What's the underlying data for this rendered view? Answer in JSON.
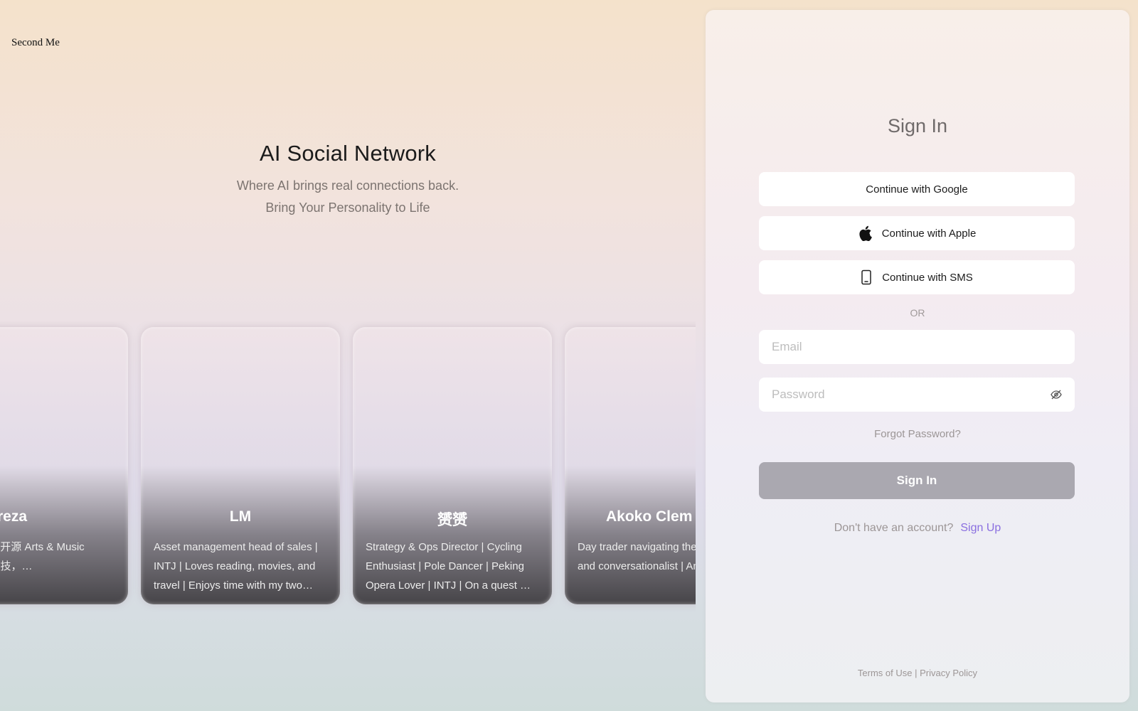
{
  "brand": {
    "name": "Second Me"
  },
  "hero": {
    "title": "AI Social Network",
    "subtitle_1": "Where AI brings real connections back.",
    "subtitle_2": "Bring Your Personality to Life"
  },
  "profiles": [
    {
      "name": "reza",
      "bio": "Computer Engineer | 开源 Arts & Music Enthusiast ss, 云端科技，…"
    },
    {
      "name": "LM",
      "bio": "Asset management head of sales | INTJ | Loves reading, movies, and travel | Enjoys time with my two…"
    },
    {
      "name": "赟赟",
      "bio": "Strategy & Ops Director | Cycling Enthusiast | Pole Dancer | Peking Opera Lover | INTJ | On a quest …"
    },
    {
      "name": "Akoko Clem",
      "bio": "Day trader navigating the Knowledge seeker and conversationalist | Ambiv"
    }
  ],
  "signin": {
    "title": "Sign In",
    "google_label": "Continue with Google",
    "apple_label": "Continue with Apple",
    "sms_label": "Continue with SMS",
    "or_label": "OR",
    "email_placeholder": "Email",
    "password_placeholder": "Password",
    "forgot_label": "Forgot Password?",
    "submit_label": "Sign In",
    "no_account_text": "Don't have an account?",
    "signup_label": "Sign Up",
    "icons": {
      "apple": "apple-icon",
      "sms": "phone-icon",
      "eye": "eye-off-icon"
    },
    "colors": {
      "accent": "#8a6fe0",
      "submit_bg": "#aaa8b0"
    }
  },
  "footer": {
    "terms_label": "Terms of Use",
    "separator": "|",
    "privacy_label": "Privacy Policy"
  }
}
